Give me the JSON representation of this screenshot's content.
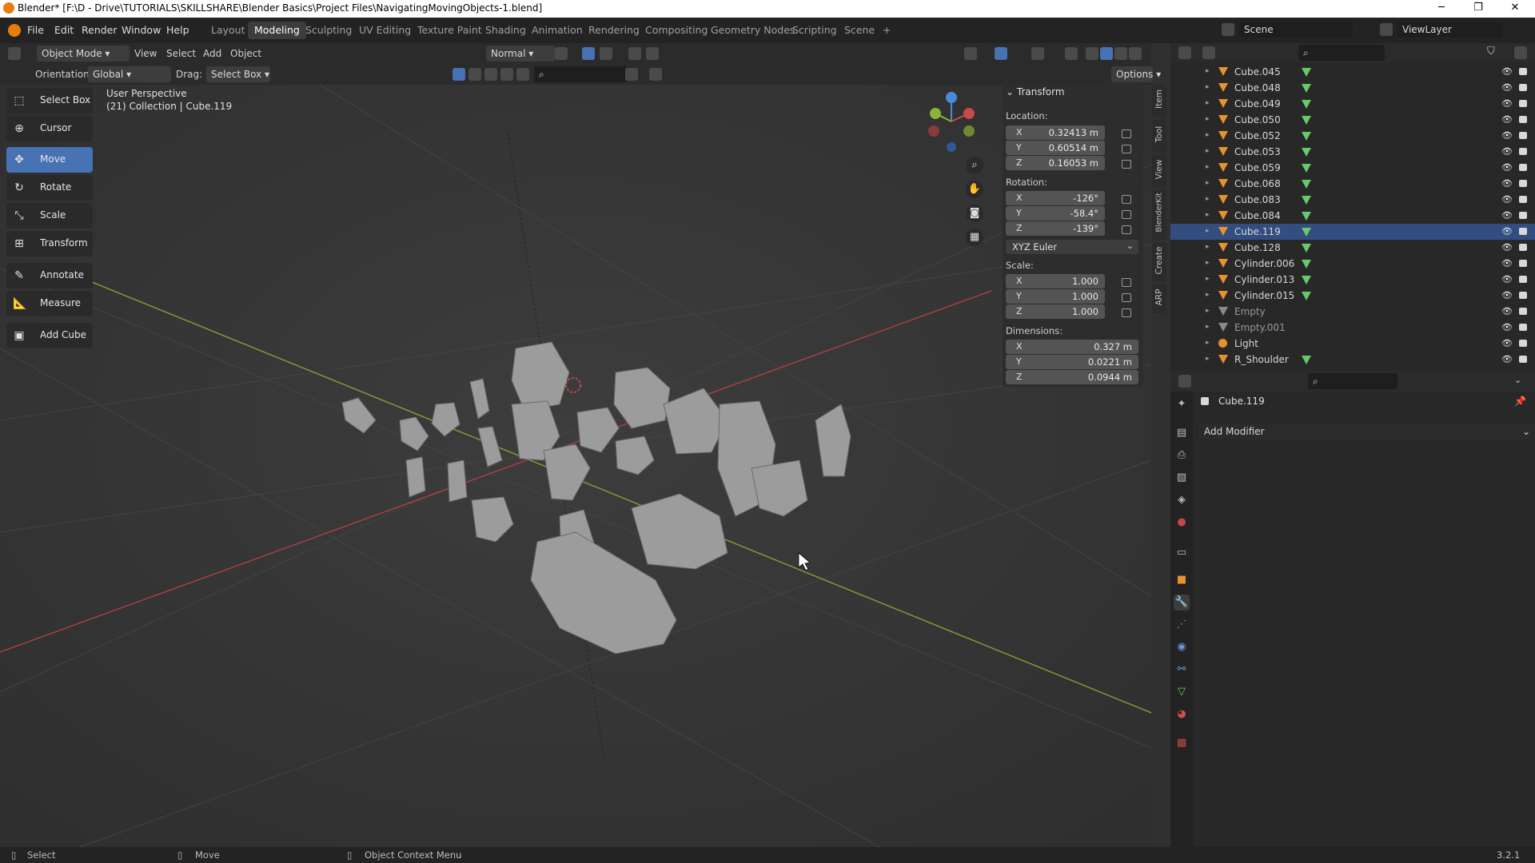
{
  "window": {
    "title": "Blender* [F:\\D - Drive\\TUTORIALS\\SKILLSHARE\\Blender Basics\\Project Files\\NavigatingMovingObjects-1.blend]",
    "minimize": "─",
    "maximize": "❐",
    "close": "✕"
  },
  "menu": [
    "File",
    "Edit",
    "Render",
    "Window",
    "Help"
  ],
  "workspaces": [
    "Layout",
    "Modeling",
    "Sculpting",
    "UV Editing",
    "Texture Paint",
    "Shading",
    "Animation",
    "Rendering",
    "Compositing",
    "Geometry Nodes",
    "Scripting",
    "Scene"
  ],
  "workspace_add": "+",
  "scene": {
    "name": "Scene",
    "view_layer": "ViewLayer"
  },
  "header": {
    "mode": "Object Mode",
    "view": "View",
    "select": "Select",
    "add": "Add",
    "object": "Object",
    "orientation_label": "Orientation:",
    "orientation": "Global",
    "drag_label": "Drag:",
    "drag": "Select Box",
    "transform_orientation": "Normal",
    "options": "Options"
  },
  "viewport": {
    "perspective": "User Perspective",
    "collection": "(21) Collection | Cube.119"
  },
  "tools": [
    {
      "label": "Select Box",
      "icon": "select-box-icon",
      "glyph": "⬚"
    },
    {
      "label": "Cursor",
      "icon": "cursor-icon",
      "glyph": "⊕"
    },
    {
      "label": "Move",
      "icon": "move-icon",
      "glyph": "✥"
    },
    {
      "label": "Rotate",
      "icon": "rotate-icon",
      "glyph": "↻"
    },
    {
      "label": "Scale",
      "icon": "scale-icon",
      "glyph": "⤡"
    },
    {
      "label": "Transform",
      "icon": "transform-icon",
      "glyph": "⊞"
    },
    {
      "label": "Annotate",
      "icon": "annotate-icon",
      "glyph": "✎"
    },
    {
      "label": "Measure",
      "icon": "measure-icon",
      "glyph": "📐"
    },
    {
      "label": "Add Cube",
      "icon": "add-cube-icon",
      "glyph": "▣"
    }
  ],
  "transform": {
    "title": "Transform",
    "location_label": "Location:",
    "location": {
      "x": "0.32413 m",
      "y": "0.60514 m",
      "z": "0.16053 m"
    },
    "rotation_label": "Rotation:",
    "rotation": {
      "x": "-126°",
      "y": "-58.4°",
      "z": "-139°"
    },
    "rotation_mode": "XYZ Euler",
    "scale_label": "Scale:",
    "scale": {
      "x": "1.000",
      "y": "1.000",
      "z": "1.000"
    },
    "dimensions_label": "Dimensions:",
    "dimensions": {
      "x": "0.327 m",
      "y": "0.0221 m",
      "z": "0.0944 m"
    },
    "axes": {
      "x": "X",
      "y": "Y",
      "z": "Z"
    }
  },
  "side_tabs": [
    "Item",
    "Tool",
    "View",
    "BlenderKit",
    "Create",
    "ARP"
  ],
  "outliner": [
    {
      "name": "Cube.045",
      "type": "mesh"
    },
    {
      "name": "Cube.048",
      "type": "mesh"
    },
    {
      "name": "Cube.049",
      "type": "mesh"
    },
    {
      "name": "Cube.050",
      "type": "mesh"
    },
    {
      "name": "Cube.052",
      "type": "mesh"
    },
    {
      "name": "Cube.053",
      "type": "mesh"
    },
    {
      "name": "Cube.059",
      "type": "mesh"
    },
    {
      "name": "Cube.068",
      "type": "mesh"
    },
    {
      "name": "Cube.083",
      "type": "mesh"
    },
    {
      "name": "Cube.084",
      "type": "mesh"
    },
    {
      "name": "Cube.119",
      "type": "mesh",
      "selected": true
    },
    {
      "name": "Cube.128",
      "type": "mesh"
    },
    {
      "name": "Cylinder.006",
      "type": "mesh"
    },
    {
      "name": "Cylinder.013",
      "type": "mesh"
    },
    {
      "name": "Cylinder.015",
      "type": "mesh"
    },
    {
      "name": "Empty",
      "type": "empty"
    },
    {
      "name": "Empty.001",
      "type": "empty"
    },
    {
      "name": "Light",
      "type": "light"
    },
    {
      "name": "R_Shoulder",
      "type": "mesh"
    }
  ],
  "properties": {
    "object_name": "Cube.119",
    "add_modifier": "Add Modifier"
  },
  "status": {
    "select": "Select",
    "move": "Move",
    "context_menu": "Object Context Menu",
    "version": "3.2.1"
  },
  "colors": {
    "accent": "#4772b3",
    "x_axis": "#c84a4a",
    "y_axis": "#8ab33a",
    "z_axis": "#4a8ad8",
    "object": "#e8912f",
    "mesh_data": "#68c86d"
  }
}
